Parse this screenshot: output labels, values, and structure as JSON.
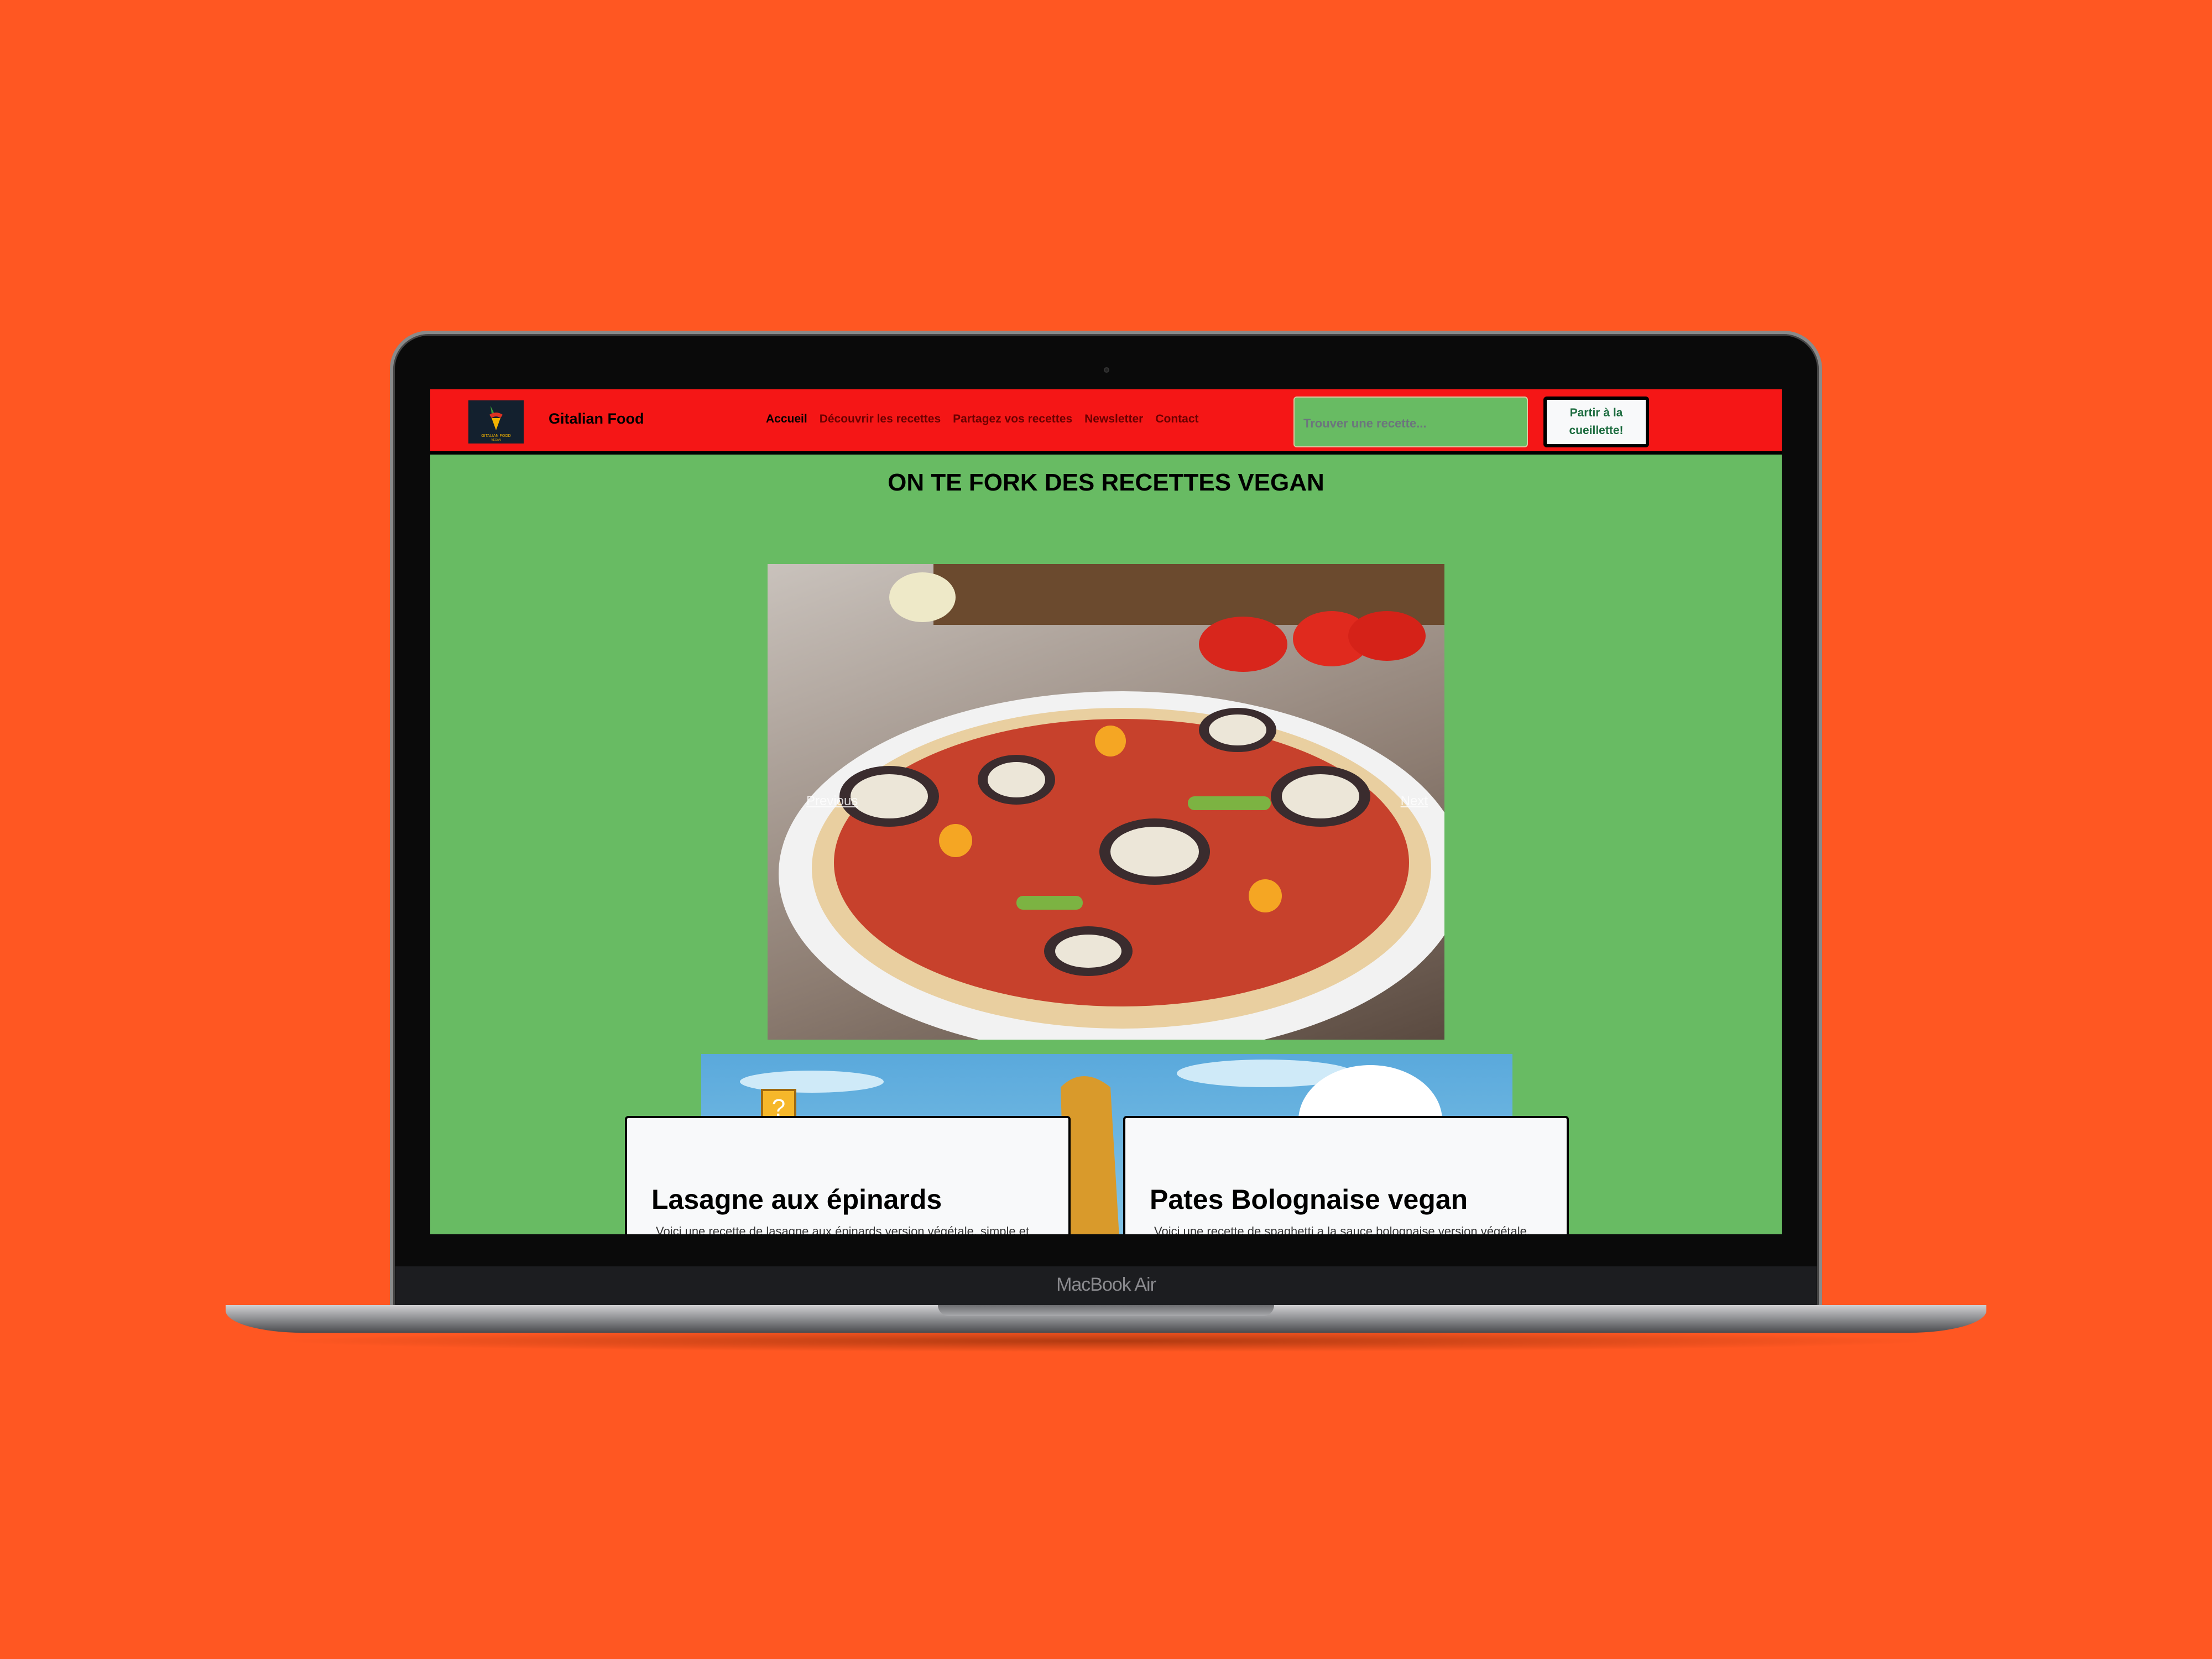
{
  "device": {
    "label": "MacBook Air"
  },
  "header": {
    "brand": "Gitalian Food",
    "logo_text": "GITALIAN FOOD VEGAN",
    "nav": [
      "Accueil",
      "Découvrir les recettes",
      "Partagez vos recettes",
      "Newsletter",
      "Contact"
    ],
    "search_placeholder": "Trouver une recette...",
    "cta": "Partir à la cueillette!"
  },
  "main": {
    "title": "ON TE FORK DES RECETTES VEGAN",
    "carousel": {
      "prev": "Previous",
      "next": "Next"
    },
    "cards": [
      {
        "title": "Lasagne aux épinards",
        "desc": "Voici une recette de lasagne aux épinards version végétale, simple et"
      },
      {
        "title": "Pates Bolognaise vegan",
        "desc": "Voici une recette de spaghetti a la sauce bolognaise version végétale."
      }
    ]
  },
  "colors": {
    "background": "#ff5722",
    "nav": "#f51616",
    "page": "#68bb63"
  }
}
